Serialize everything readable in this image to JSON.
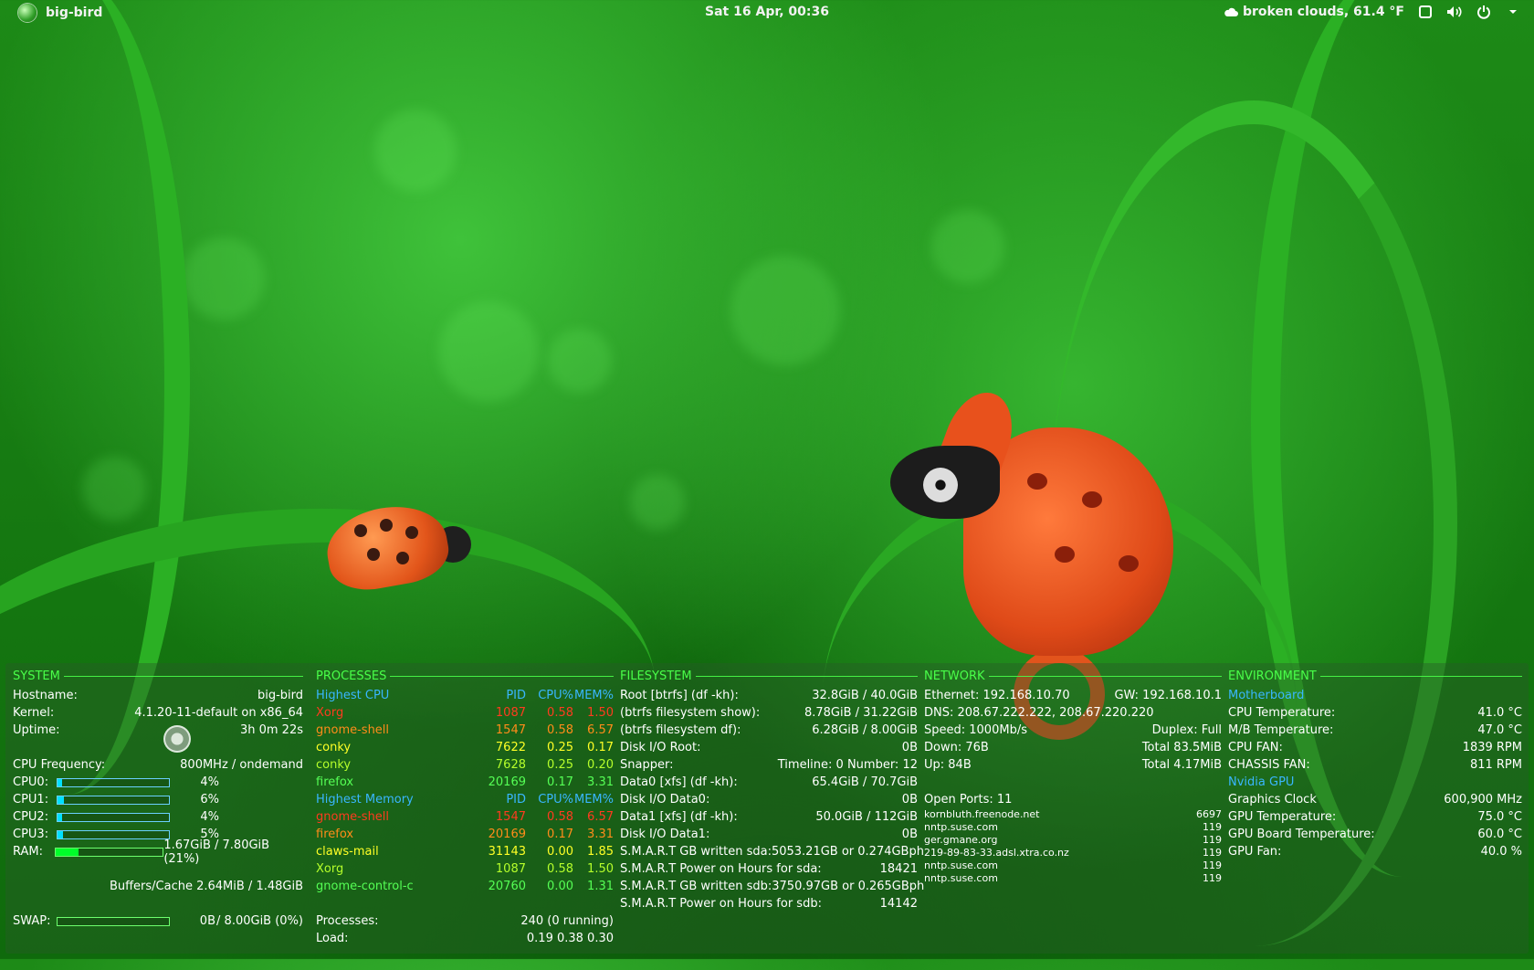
{
  "topbar": {
    "host": "big-bird",
    "clock": "Sat 16 Apr, 00:36",
    "weather": "broken clouds, 61.4 °F"
  },
  "conky": {
    "system": {
      "title": "SYSTEM",
      "hostname_label": "Hostname:",
      "hostname": "big-bird",
      "kernel_label": "Kernel:",
      "kernel": "4.1.20-11-default on x86_64",
      "uptime_label": "Uptime:",
      "uptime": "3h 0m 22s",
      "cpufreq_label": "CPU Frequency:",
      "cpufreq": "800MHz / ondemand",
      "cpus": [
        {
          "label": "CPU0:",
          "pct": "4%",
          "level": 0.04
        },
        {
          "label": "CPU1:",
          "pct": "6%",
          "level": 0.06
        },
        {
          "label": "CPU2:",
          "pct": "4%",
          "level": 0.04
        },
        {
          "label": "CPU3:",
          "pct": "5%",
          "level": 0.05
        }
      ],
      "ram_label": "RAM:",
      "ram": "1.67GiB / 7.80GiB (21%)",
      "ram_level": 0.21,
      "buffers": "Buffers/Cache 2.64MiB / 1.48GiB",
      "swap_label": "SWAP:",
      "swap_used": "0B",
      "swap_total": "/ 8.00GiB (0%)",
      "swap_level": 0.0
    },
    "processes": {
      "title": "PROCESSES",
      "cpu_header": {
        "name": "Highest CPU",
        "pid": "PID",
        "cpu": "CPU%",
        "mem": "MEM%"
      },
      "cpu_rows": [
        {
          "name": "Xorg",
          "pid": "1087",
          "cpu": "0.58",
          "mem": "1.50",
          "color": "#ff3b1f"
        },
        {
          "name": "gnome-shell",
          "pid": "1547",
          "cpu": "0.58",
          "mem": "6.57",
          "color": "#ff8c1a"
        },
        {
          "name": "conky",
          "pid": "7622",
          "cpu": "0.25",
          "mem": "0.17",
          "color": "#ffff26"
        },
        {
          "name": "conky",
          "pid": "7628",
          "cpu": "0.25",
          "mem": "0.20",
          "color": "#b6ff2b"
        },
        {
          "name": "firefox",
          "pid": "20169",
          "cpu": "0.17",
          "mem": "3.31",
          "color": "#55ff55"
        }
      ],
      "mem_header": {
        "name": "Highest Memory",
        "pid": "PID",
        "cpu": "CPU%",
        "mem": "MEM%"
      },
      "mem_rows": [
        {
          "name": "gnome-shell",
          "pid": "1547",
          "cpu": "0.58",
          "mem": "6.57",
          "color": "#ff3b1f"
        },
        {
          "name": "firefox",
          "pid": "20169",
          "cpu": "0.17",
          "mem": "3.31",
          "color": "#ff8c1a"
        },
        {
          "name": "claws-mail",
          "pid": "31143",
          "cpu": "0.00",
          "mem": "1.85",
          "color": "#ffff26"
        },
        {
          "name": "Xorg",
          "pid": "1087",
          "cpu": "0.58",
          "mem": "1.50",
          "color": "#b6ff2b"
        },
        {
          "name": "gnome-control-c",
          "pid": "20760",
          "cpu": "0.00",
          "mem": "1.31",
          "color": "#55ff55"
        }
      ],
      "processes_label": "Processes:",
      "processes": "240 (0 running)",
      "load_label": "Load:",
      "load": "0.19 0.38 0.30"
    },
    "filesystem": {
      "title": "FILESYSTEM",
      "rows": [
        {
          "label": "Root [btrfs] (df -kh):",
          "value": "32.8GiB / 40.0GiB"
        },
        {
          "label": "(btrfs filesystem show):",
          "value": "8.78GiB / 31.22GiB"
        },
        {
          "label": "(btrfs filesystem df):",
          "value": "6.28GiB / 8.00GiB"
        },
        {
          "label": "Disk I/O Root:",
          "value": "0B"
        },
        {
          "label": "Snapper:",
          "value": "Timeline: 0 Number: 12"
        },
        {
          "label": "Data0 [xfs] (df -kh):",
          "value": "65.4GiB / 70.7GiB"
        },
        {
          "label": "Disk I/O Data0:",
          "value": "0B"
        },
        {
          "label": "Data1 [xfs] (df -kh):",
          "value": "50.0GiB / 112GiB"
        },
        {
          "label": "Disk I/O Data1:",
          "value": "0B"
        },
        {
          "label": "S.M.A.R.T GB written sda:",
          "value": "5053.21GB or 0.274GBph"
        },
        {
          "label": "S.M.A.R.T Power on Hours for sda:",
          "value": "18421"
        },
        {
          "label": "S.M.A.R.T GB written sdb:",
          "value": "3750.97GB or 0.265GBph"
        },
        {
          "label": "S.M.A.R.T Power on Hours for sdb:",
          "value": "14142"
        }
      ]
    },
    "network": {
      "title": "NETWORK",
      "ethernet": "Ethernet: 192.168.10.70",
      "gw": "GW: 192.168.10.1",
      "dns": "DNS: 208.67.222.222, 208.67.220.220",
      "speed": "Speed: 1000Mb/s",
      "duplex": "Duplex: Full",
      "down": "Down: 76B",
      "total_down": "Total 83.5MiB",
      "up": "Up: 84B",
      "total_up": "Total 4.17MiB",
      "open_ports": "Open Ports: 11",
      "ports": [
        {
          "host": "kornbluth.freenode.net",
          "port": "6697"
        },
        {
          "host": "nntp.suse.com",
          "port": "119"
        },
        {
          "host": "ger.gmane.org",
          "port": "119"
        },
        {
          "host": "219-89-83-33.adsl.xtra.co.nz",
          "port": "119"
        },
        {
          "host": "nntp.suse.com",
          "port": "119"
        },
        {
          "host": "nntp.suse.com",
          "port": "119"
        }
      ]
    },
    "environment": {
      "title": "ENVIRONMENT",
      "mb_title": "Motherboard",
      "mb_rows": [
        {
          "label": "CPU Temperature:",
          "value": "41.0 °C"
        },
        {
          "label": "M/B Temperature:",
          "value": "47.0 °C"
        },
        {
          "label": "CPU FAN:",
          "value": "1839 RPM"
        },
        {
          "label": "CHASSIS FAN:",
          "value": "811 RPM"
        }
      ],
      "gpu_title": "Nvidia GPU",
      "gpu_rows": [
        {
          "label": "Graphics Clock",
          "value": "600,900 MHz"
        },
        {
          "label": "GPU Temperature:",
          "value": "75.0 °C"
        },
        {
          "label": "GPU Board Temperature:",
          "value": "60.0 °C"
        },
        {
          "label": "GPU Fan:",
          "value": "40.0 %"
        }
      ]
    }
  },
  "icons": {
    "tray": [
      "weather-cloud-icon",
      "window-icon",
      "volume-icon",
      "power-icon",
      "chevron-down-icon"
    ]
  }
}
